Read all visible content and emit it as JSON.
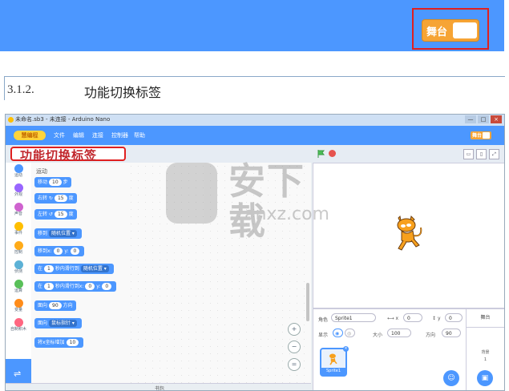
{
  "top": {
    "stage_label": "舞台"
  },
  "section": {
    "number": "3.1.2.",
    "title": "功能切换标签"
  },
  "window": {
    "title": "未命名.sb3 - 未连接 - Arduino Nano",
    "buttons": [
      "—",
      "□",
      "×"
    ]
  },
  "menubar": {
    "logo": "慧编程",
    "items": [
      "文件",
      "编辑",
      "连接",
      "控制器",
      "帮助"
    ],
    "stage_label": "舞台"
  },
  "callout": {
    "text": "功能切换标签"
  },
  "categories": [
    {
      "label": "运动",
      "color": "#4c97ff"
    },
    {
      "label": "外观",
      "color": "#9966ff"
    },
    {
      "label": "声音",
      "color": "#cf63cf"
    },
    {
      "label": "事件",
      "color": "#ffbf00"
    },
    {
      "label": "控制",
      "color": "#ffab19"
    },
    {
      "label": "侦测",
      "color": "#5cb1d6"
    },
    {
      "label": "运算",
      "color": "#59c059"
    },
    {
      "label": "变量",
      "color": "#ff8c1a"
    },
    {
      "label": "自制积木",
      "color": "#ff6680"
    }
  ],
  "palette": {
    "section_title": "运动",
    "blocks": [
      {
        "parts": [
          {
            "t": "text",
            "v": "移动"
          },
          {
            "t": "oval",
            "v": "10"
          },
          {
            "t": "text",
            "v": "步"
          }
        ]
      },
      {
        "parts": [
          {
            "t": "text",
            "v": "右转 ↻"
          },
          {
            "t": "oval",
            "v": "15"
          },
          {
            "t": "text",
            "v": "度"
          }
        ]
      },
      {
        "parts": [
          {
            "t": "text",
            "v": "左转 ↺"
          },
          {
            "t": "oval",
            "v": "15"
          },
          {
            "t": "text",
            "v": "度"
          }
        ]
      },
      {
        "parts": [
          {
            "t": "text",
            "v": "移到"
          },
          {
            "t": "dd",
            "v": "随机位置 ▾"
          }
        ]
      },
      {
        "parts": [
          {
            "t": "text",
            "v": "移到x:"
          },
          {
            "t": "oval",
            "v": "0"
          },
          {
            "t": "text",
            "v": "y:"
          },
          {
            "t": "oval",
            "v": "0"
          }
        ]
      },
      {
        "parts": [
          {
            "t": "text",
            "v": "在"
          },
          {
            "t": "oval",
            "v": "1"
          },
          {
            "t": "text",
            "v": "秒内滑行到"
          },
          {
            "t": "dd",
            "v": "随机位置 ▾"
          }
        ]
      },
      {
        "parts": [
          {
            "t": "text",
            "v": "在"
          },
          {
            "t": "oval",
            "v": "1"
          },
          {
            "t": "text",
            "v": "秒内滑行到x:"
          },
          {
            "t": "oval",
            "v": "0"
          },
          {
            "t": "text",
            "v": "y:"
          },
          {
            "t": "oval",
            "v": "0"
          }
        ]
      },
      {
        "parts": [
          {
            "t": "text",
            "v": "面向"
          },
          {
            "t": "oval",
            "v": "90"
          },
          {
            "t": "text",
            "v": "方向"
          }
        ]
      },
      {
        "parts": [
          {
            "t": "text",
            "v": "面向"
          },
          {
            "t": "dd",
            "v": "鼠标指针 ▾"
          }
        ]
      },
      {
        "parts": [
          {
            "t": "text",
            "v": "将x坐标增加"
          },
          {
            "t": "oval",
            "v": "10"
          }
        ]
      }
    ]
  },
  "extension_icon": "extension-icon",
  "zoom": [
    "+",
    "−",
    "="
  ],
  "backpack": "书包",
  "sprite": {
    "name_label": "角色",
    "name_value": "Sprite1",
    "x_label": "x",
    "x_value": "0",
    "y_label": "y",
    "y_value": "0",
    "show_label": "显示",
    "size_label": "大小",
    "size_value": "100",
    "direction_label": "方向",
    "direction_value": "90",
    "thumb_name": "Sprite1"
  },
  "stage_panel": {
    "title": "舞台",
    "backdrops_label": "背景",
    "backdrops_count": "1"
  },
  "watermark": {
    "main": "安下载",
    "sub": "anxz.com"
  },
  "colors": {
    "scratch_blue": "#4c97ff",
    "highlight_red": "#e02020",
    "stage_orange": "#f6a435"
  }
}
